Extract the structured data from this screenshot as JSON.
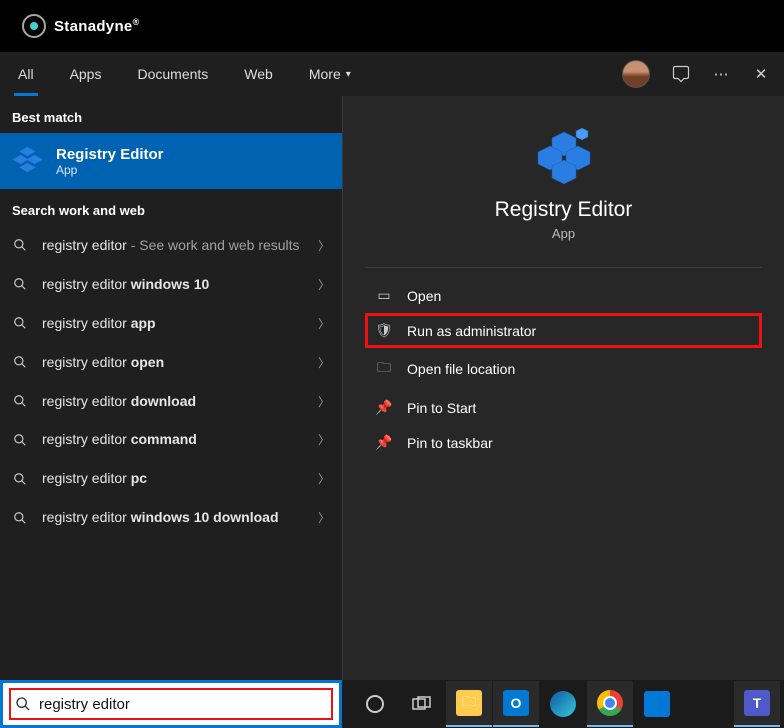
{
  "brand": "Stanadyne",
  "tabs": {
    "all": "All",
    "apps": "Apps",
    "documents": "Documents",
    "web": "Web",
    "more": "More"
  },
  "left": {
    "best_match_hdr": "Best match",
    "best_match_title": "Registry Editor",
    "best_match_sub": "App",
    "search_web_hdr": "Search work and web",
    "suggestions": [
      {
        "pre": "registry editor",
        "dim": " - See work and web results",
        "bold": ""
      },
      {
        "pre": "registry editor ",
        "dim": "",
        "bold": "windows 10"
      },
      {
        "pre": "registry editor ",
        "dim": "",
        "bold": "app"
      },
      {
        "pre": "registry editor ",
        "dim": "",
        "bold": "open"
      },
      {
        "pre": "registry editor ",
        "dim": "",
        "bold": "download"
      },
      {
        "pre": "registry editor ",
        "dim": "",
        "bold": "command"
      },
      {
        "pre": "registry editor ",
        "dim": "",
        "bold": "pc"
      },
      {
        "pre": "registry editor ",
        "dim": "",
        "bold": "windows 10 download"
      }
    ]
  },
  "right": {
    "title": "Registry Editor",
    "sub": "App",
    "actions": {
      "open": "Open",
      "admin": "Run as administrator",
      "loc": "Open file location",
      "pin_start": "Pin to Start",
      "pin_tb": "Pin to taskbar"
    }
  },
  "search": {
    "value": "registry editor"
  }
}
